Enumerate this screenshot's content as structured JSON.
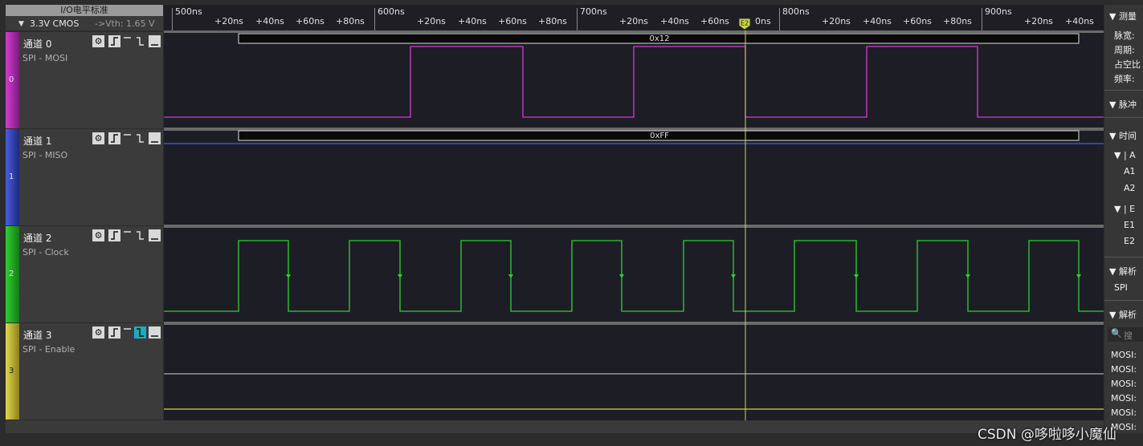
{
  "io_header": {
    "title": "I/O电平标准",
    "level": "3.3V CMOS",
    "arrow": "->",
    "vth": "Vth: 1.65 V"
  },
  "ruler": {
    "major_labels": [
      "500ns",
      "600ns",
      "700ns",
      "800ns",
      "900ns"
    ],
    "minor_labels": [
      "+20ns",
      "+40ns",
      "+60ns",
      "+80ns"
    ],
    "cursor_label": "E2",
    "cursor_tail": "0ns"
  },
  "channels": [
    {
      "index": "0",
      "name": "通道 0",
      "signal": "SPI - MOSI",
      "color": "#d63ad6",
      "decode": "0x12"
    },
    {
      "index": "1",
      "name": "通道 1",
      "signal": "SPI - MISO",
      "color": "#4a5ce0",
      "decode": "0xFF"
    },
    {
      "index": "2",
      "name": "通道 2",
      "signal": "SPI - Clock",
      "color": "#2fd02f"
    },
    {
      "index": "3",
      "name": "通道 3",
      "signal": "SPI - Enable",
      "color": "#d8cf3a"
    }
  ],
  "toolbar_icons": [
    "gear-icon",
    "rising-edge-icon",
    "high-level-icon",
    "falling-edge-icon",
    "low-level-icon"
  ],
  "sidebar": {
    "measure": "测量",
    "measure_items": [
      "脉宽:",
      "周期:",
      "占空比",
      "频率:"
    ],
    "pulse": "脉冲",
    "time": "时间",
    "a_group": "A",
    "a_items": [
      "A1",
      "A2"
    ],
    "e_group": "E",
    "e_items": [
      "E1",
      "E2"
    ],
    "decode1": "解析",
    "decode1_item": "SPI",
    "decode2": "解析",
    "search_placeholder": "搜",
    "mosi_rows": [
      "MOSI:",
      "MOSI:",
      "MOSI:",
      "MOSI:",
      "MOSI:",
      "MOSI:"
    ]
  },
  "watermark": "CSDN @哆啦哆小魔仙",
  "colors": {
    "cursor": "#c8d84a",
    "plot_bg": "#1d1d26",
    "panel_bg": "#3b3b3b"
  }
}
